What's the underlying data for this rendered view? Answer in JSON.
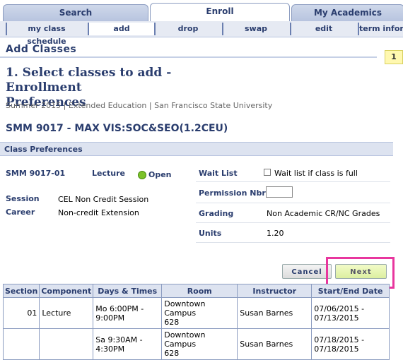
{
  "tabs": [
    "Search",
    "Enroll",
    "My Academics"
  ],
  "subtabs": [
    "my class schedule",
    "add",
    "drop",
    "swap",
    "edit",
    "term inform"
  ],
  "page_title": "Add Classes",
  "step_badge": "1",
  "step_heading_line1": "1.  Select classes to add - Enrollment",
  "step_heading_line2": "Preferences",
  "term_line": "Summer 2015 | Extended Education | San Francisco State University",
  "course_title": "SMM 9017 - MAX VIS:SOC&SEO(1.2CEU)",
  "prefs_header": "Class Preferences",
  "section": {
    "code": "SMM 9017-01",
    "type": "Lecture",
    "status": "Open",
    "session_label": "Session",
    "session_value": "CEL Non Credit Session",
    "career_label": "Career",
    "career_value": "Non-credit Extension"
  },
  "prefs": {
    "waitlist_label": "Wait List",
    "waitlist_checkbox_label": "Wait list if class is full",
    "permission_label": "Permission Nbr",
    "permission_value": "",
    "grading_label": "Grading",
    "grading_value": "Non Academic CR/NC Grades",
    "units_label": "Units",
    "units_value": "1.20"
  },
  "buttons": {
    "cancel": "Cancel",
    "next": "Next"
  },
  "table": {
    "headers": [
      "Section",
      "Component",
      "Days & Times",
      "Room",
      "Instructor",
      "Start/End Date"
    ],
    "rows": [
      {
        "section": "01",
        "component": "Lecture",
        "days_line1": "Mo 6:00PM -",
        "days_line2": "9:00PM",
        "room_line1": "Downtown Campus",
        "room_line2": "628",
        "instructor": "Susan Barnes",
        "dates_line1": "07/06/2015 -",
        "dates_line2": "07/13/2015"
      },
      {
        "section": "",
        "component": "",
        "days_line1": "Sa 9:30AM -",
        "days_line2": "4:30PM",
        "room_line1": "Downtown Campus",
        "room_line2": "628",
        "instructor": "Susan Barnes",
        "dates_line1": "07/18/2015 -",
        "dates_line2": "07/18/2015"
      }
    ]
  },
  "colors": {
    "nav_text": "#2a3d6e",
    "open_status": "#7bc22a",
    "highlight": "#e8369e"
  }
}
